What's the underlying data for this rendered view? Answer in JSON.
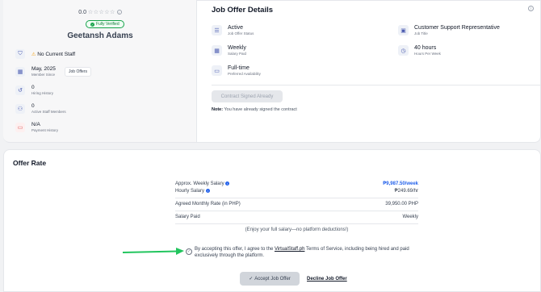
{
  "profile": {
    "rating": "0.0",
    "stars": "☆☆☆☆☆",
    "verified_label": "Fully Verified",
    "name": "Geetansh Adams",
    "staff_status": "No Current Staff",
    "member_since": {
      "value": "May, 2025",
      "label": "Member Since"
    },
    "job_offers_button": "Job Offers",
    "hiring_history": {
      "value": "0",
      "label": "Hiring History"
    },
    "active_staff": {
      "value": "0",
      "label": "Active Staff Members"
    },
    "payment_history": {
      "value": "N/A",
      "label": "Payment History"
    }
  },
  "job_offer": {
    "title": "Job Offer Details",
    "status": {
      "value": "Active",
      "label": "Job Offer Status"
    },
    "job_title": {
      "value": "Customer Support Representative",
      "label": "Job Title"
    },
    "salary_paid": {
      "value": "Weekly",
      "label": "Salary Paid"
    },
    "hours": {
      "value": "40 hours",
      "label": "Hours Per Week"
    },
    "availability": {
      "value": "Full-time",
      "label": "Preferred Availability"
    },
    "signed_button": "Contract Signed Already",
    "note_label": "Note:",
    "note_text": "You have already signed the contract"
  },
  "offer_rate": {
    "title": "Offer Rate",
    "weekly_label": "Approx. Weekly Salary",
    "weekly_value": "₱9,987.50/week",
    "hourly_label": "Hourly Salary",
    "hourly_value": "₱249.69/hr",
    "monthly_label": "Agreed Monthly Rate (in PHP)",
    "monthly_value": "39,950.00 PHP",
    "salary_paid_label": "Salary Paid",
    "salary_paid_value": "Weekly",
    "enjoy_text": "(Enjoy your full salary—no platform deductions!)",
    "terms_prefix": "By accepting this offer, I agree to the ",
    "terms_link": "VirtualStaff.ph",
    "terms_suffix": " Terms of Service, including being hired and paid exclusively through the platform.",
    "accept_button": "Accept Job Offer",
    "decline_link": "Decline Job Offer"
  },
  "colors": {
    "accent": "#2563eb",
    "verified": "#16a34a",
    "arrow": "#22c55e"
  }
}
